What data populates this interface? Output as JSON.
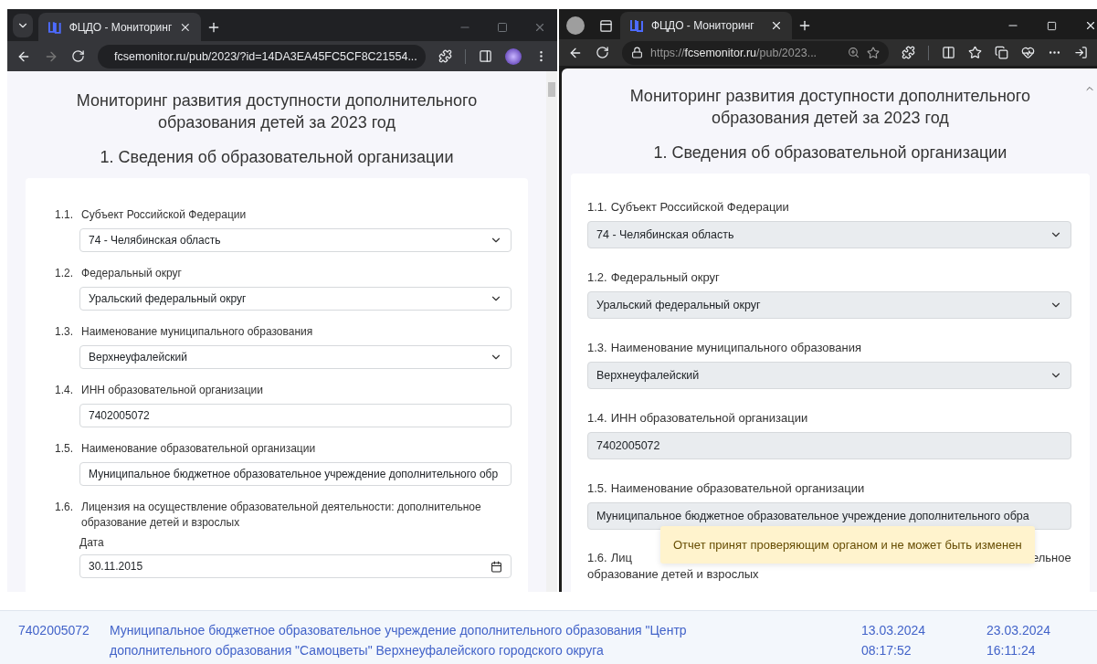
{
  "windows": [
    {
      "kind": "chrome",
      "tab": {
        "title": "ФЦДО - Мониторинг"
      },
      "url": "fcsemonitor.ru/pub/2023/?id=14DA3EA45FC5CF8C21554...",
      "page": {
        "title": "Мониторинг развития доступности дополнительного образования детей за 2023 год",
        "section": "1. Сведения об образовательной организации",
        "fields": [
          {
            "number": "1.1.",
            "label": "Субъект Российской Федерации",
            "kind": "select",
            "value": "74 - Челябинская область",
            "disabled": false
          },
          {
            "number": "1.2.",
            "label": "Федеральный округ",
            "kind": "select",
            "value": "Уральский федеральный округ",
            "disabled": false
          },
          {
            "number": "1.3.",
            "label": "Наименование муниципального образования",
            "kind": "select",
            "value": "Верхнеуфалейский",
            "disabled": false
          },
          {
            "number": "1.4.",
            "label": "ИНН образовательной организации",
            "kind": "input",
            "value": "7402005072",
            "disabled": false
          },
          {
            "number": "1.5.",
            "label": "Наименование образовательной организации",
            "kind": "input",
            "value": "Муниципальное бюджетное образовательное учреждение дополнительного обр",
            "disabled": false
          },
          {
            "number": "1.6.",
            "label": "Лицензия на осуществление образовательной деятельности: дополнительное образование детей и взрослых",
            "kind": "date",
            "sublabel": "Дата",
            "value": "30.11.2015",
            "disabled": false
          }
        ]
      }
    },
    {
      "kind": "edge",
      "tab": {
        "title": "ФЦДО - Мониторинг"
      },
      "url_scheme": "https://",
      "url_host": "fcsemonitor.ru",
      "url_path": "/pub/2023...",
      "page": {
        "title": "Мониторинг развития доступности дополнительного образования детей за 2023 год",
        "section": "1. Сведения об образовательной организации",
        "toast": {
          "text": "Отчет принят проверяющим органом и не может быть изменен"
        },
        "fields": [
          {
            "number": "1.1.",
            "label": "Субъект Российской Федерации",
            "kind": "select",
            "value": "74 - Челябинская область",
            "disabled": true
          },
          {
            "number": "1.2.",
            "label": "Федеральный округ",
            "kind": "select",
            "value": "Уральский федеральный округ",
            "disabled": true
          },
          {
            "number": "1.3.",
            "label": "Наименование муниципального образования",
            "kind": "select",
            "value": "Верхнеуфалейский",
            "disabled": true
          },
          {
            "number": "1.4.",
            "label": "ИНН образовательной организации",
            "kind": "input",
            "value": "7402005072",
            "disabled": true
          },
          {
            "number": "1.5.",
            "label": "Наименование образовательной организации",
            "kind": "input",
            "value": "Муниципальное бюджетное образовательное учреждение дополнительного обра",
            "disabled": true
          },
          {
            "number": "1.6.",
            "kind": "covered",
            "label_start": "Лиц",
            "label_end": "ельное",
            "label_line2": "образование детей и взрослых"
          }
        ]
      }
    }
  ],
  "report_row": {
    "cells": [
      {
        "texts": [
          "7402005072"
        ]
      },
      {
        "texts": [
          "Муниципальное бюджетное образовательное учреждение дополнительного образования \"Центр дополнительного образования \"Самоцветы\" Верхнеуфалейского городского округа"
        ]
      },
      {
        "texts": [
          "13.03.2024",
          "08:17:52"
        ]
      },
      {
        "texts": [
          "23.03.2024",
          "16:11:24"
        ]
      }
    ]
  }
}
